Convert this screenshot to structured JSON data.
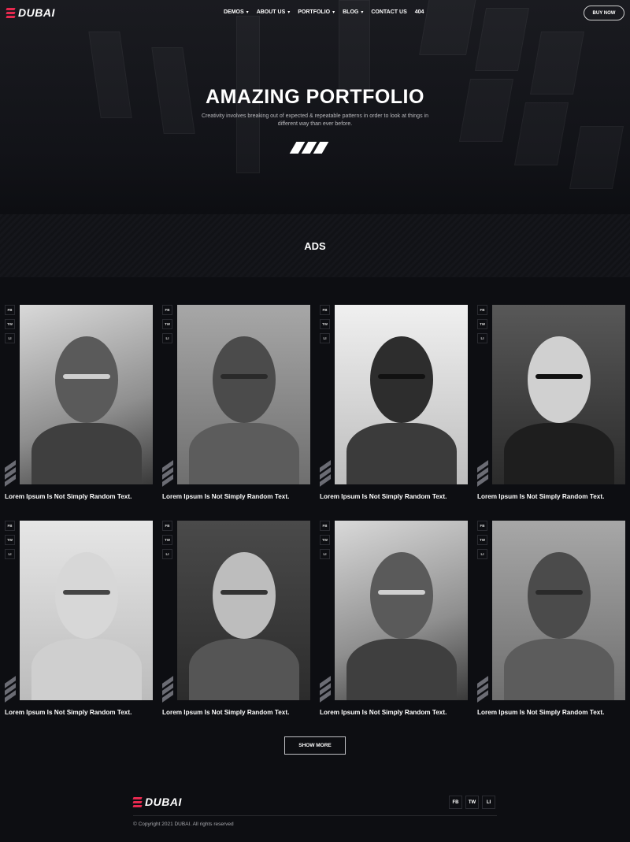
{
  "brand": {
    "name": "DUBAI",
    "accent": "#e6294f"
  },
  "nav": {
    "items": [
      {
        "label": "DEMOS",
        "has_dropdown": true
      },
      {
        "label": "ABOUT US",
        "has_dropdown": true
      },
      {
        "label": "PORTFOLIO",
        "has_dropdown": true
      },
      {
        "label": "BLOG",
        "has_dropdown": true
      },
      {
        "label": "CONTACT US",
        "has_dropdown": false
      },
      {
        "label": "404",
        "has_dropdown": false
      }
    ],
    "cta": "BUY NOW"
  },
  "hero": {
    "title": "AMAZING PORTFOLIO",
    "subtitle": "Creativity involves breaking out of expected & repeatable patterns in order to look at things in different way than ever before."
  },
  "section": {
    "title": "ADS"
  },
  "cards": [
    {
      "title": "Lorem Ipsum Is Not Simply Random Text.",
      "socials": [
        "FB",
        "TW",
        "LI"
      ]
    },
    {
      "title": "Lorem Ipsum Is Not Simply Random Text.",
      "socials": [
        "FB",
        "TW",
        "LI"
      ]
    },
    {
      "title": "Lorem Ipsum Is Not Simply Random Text.",
      "socials": [
        "FB",
        "TW",
        "LI"
      ]
    },
    {
      "title": "Lorem Ipsum Is Not Simply Random Text.",
      "socials": [
        "FB",
        "TW",
        "LI"
      ]
    },
    {
      "title": "Lorem Ipsum Is Not Simply Random Text.",
      "socials": [
        "FB",
        "TW",
        "LI"
      ]
    },
    {
      "title": "Lorem Ipsum Is Not Simply Random Text.",
      "socials": [
        "FB",
        "TW",
        "LI"
      ]
    },
    {
      "title": "Lorem Ipsum Is Not Simply Random Text.",
      "socials": [
        "FB",
        "TW",
        "LI"
      ]
    },
    {
      "title": "Lorem Ipsum Is Not Simply Random Text.",
      "socials": [
        "FB",
        "TW",
        "LI"
      ]
    }
  ],
  "show_more": "SHOW MORE",
  "footer": {
    "brand": "DUBAI",
    "socials": [
      "FB",
      "TW",
      "LI"
    ],
    "copyright": "© Copyright 2021 DUBAI. All rights reserved"
  },
  "icons": {
    "dropdown": "chevron-down-icon",
    "social_fb": "facebook-icon",
    "social_tw": "twitter-icon",
    "social_li": "linkedin-icon"
  }
}
